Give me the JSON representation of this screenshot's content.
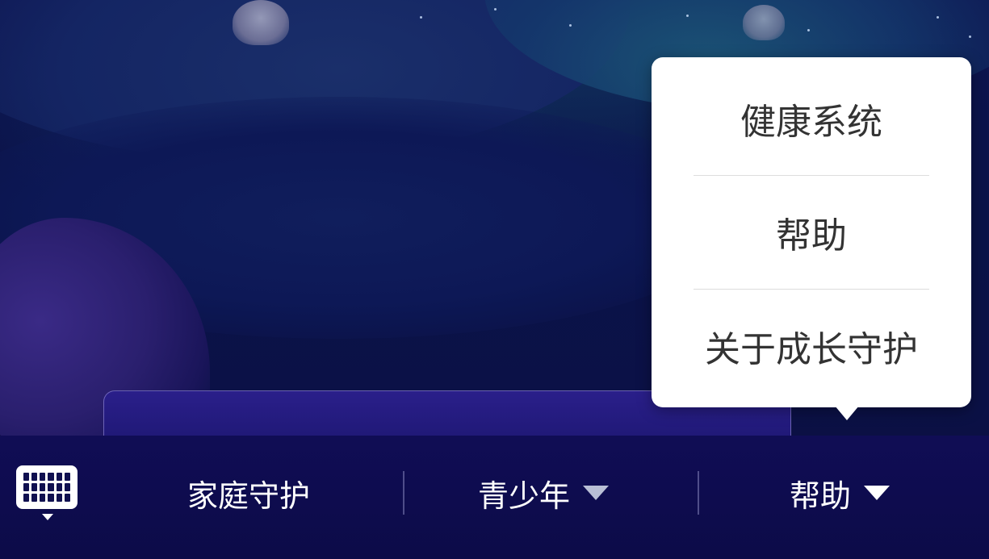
{
  "bottom_nav": {
    "keyboard_icon": "keyboard-icon",
    "items": [
      {
        "label": "家庭守护",
        "has_dropdown": false
      },
      {
        "label": "青少年",
        "has_dropdown": true
      },
      {
        "label": "帮助",
        "has_dropdown": true
      }
    ]
  },
  "help_menu": {
    "items": [
      {
        "label": "健康系统"
      },
      {
        "label": "帮助"
      },
      {
        "label": "关于成长守护"
      }
    ]
  },
  "colors": {
    "background": "#0b1147",
    "bottom_bar": "#0c0b48",
    "popup_background": "#ffffff",
    "popup_text": "#333333",
    "nav_text": "#ffffff"
  }
}
